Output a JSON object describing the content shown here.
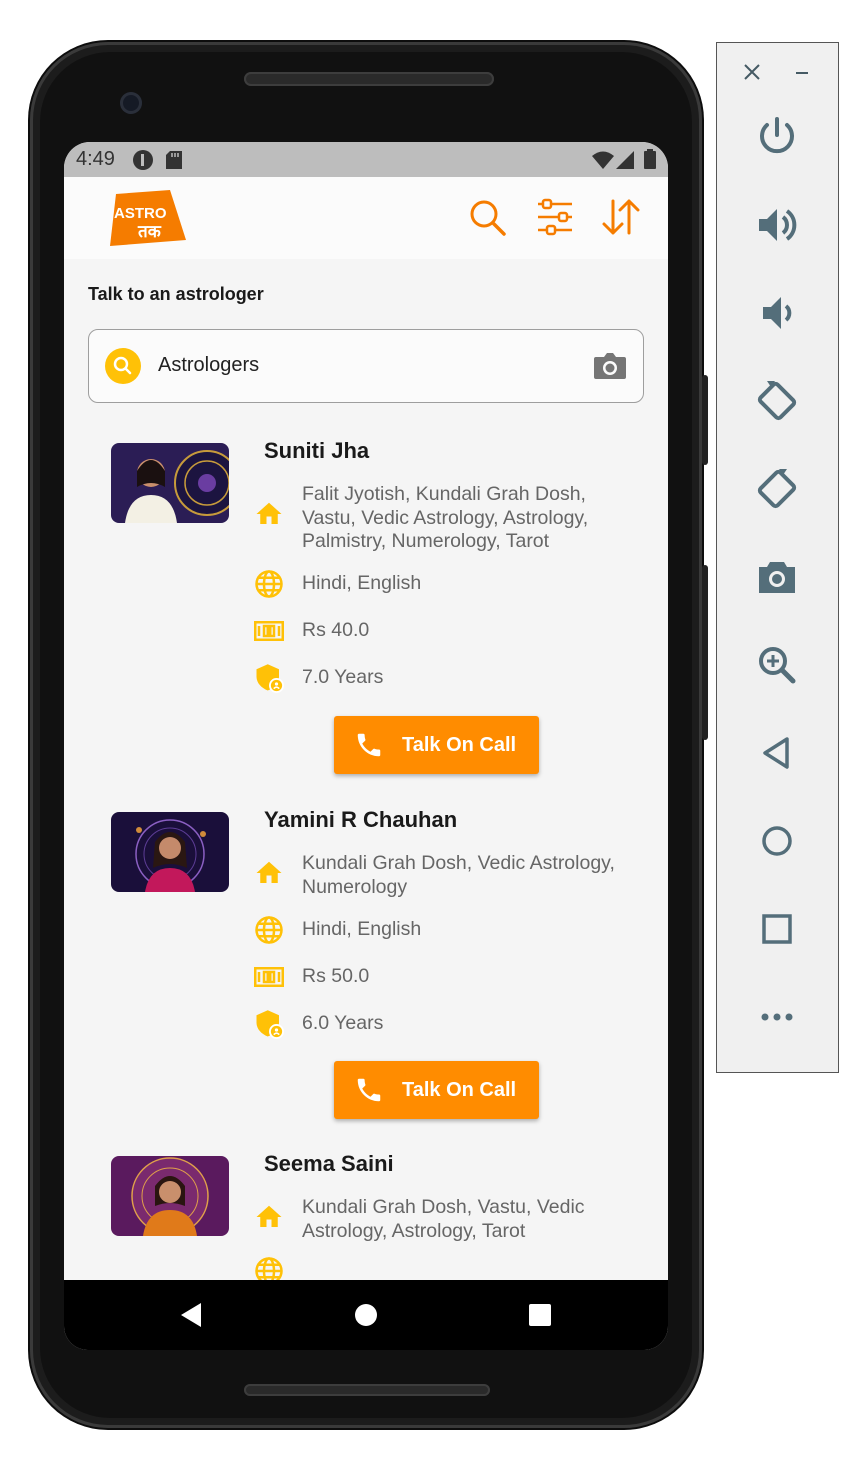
{
  "status_bar": {
    "time": "4:49"
  },
  "header": {
    "logo_text_top": "ASTRO",
    "logo_text_bottom": "तक"
  },
  "page": {
    "section_title": "Talk to an astrologer",
    "search": {
      "value": "Astrologers"
    }
  },
  "astrologers": [
    {
      "name": "Suniti Jha",
      "skills": "Falit Jyotish, Kundali Grah Dosh, Vastu, Vedic Astrology, Astrology, Palmistry, Numerology, Tarot",
      "languages": "Hindi, English",
      "price": "Rs 40.0",
      "experience": "7.0 Years",
      "button": "Talk On Call"
    },
    {
      "name": "Yamini R Chauhan",
      "skills": "Kundali Grah Dosh, Vedic Astrology, Numerology",
      "languages": "Hindi, English",
      "price": "Rs 50.0",
      "experience": "6.0 Years",
      "button": "Talk On Call"
    },
    {
      "name": "Seema Saini",
      "skills": "Kundali Grah Dosh, Vastu, Vedic Astrology, Astrology, Tarot"
    }
  ],
  "colors": {
    "accent": "#ff8c00",
    "icon_yellow": "#ffc107",
    "brand_orange": "#f57c00"
  },
  "icons": {
    "appbar": [
      "search-icon",
      "filter-icon",
      "sort-icon"
    ],
    "emulator_panel": [
      "close-icon",
      "minimize-icon",
      "power-icon",
      "volume-up-icon",
      "volume-down-icon",
      "rotate-left-icon",
      "rotate-right-icon",
      "screenshot-icon",
      "zoom-icon",
      "back-icon",
      "home-icon",
      "overview-icon",
      "more-icon"
    ]
  }
}
